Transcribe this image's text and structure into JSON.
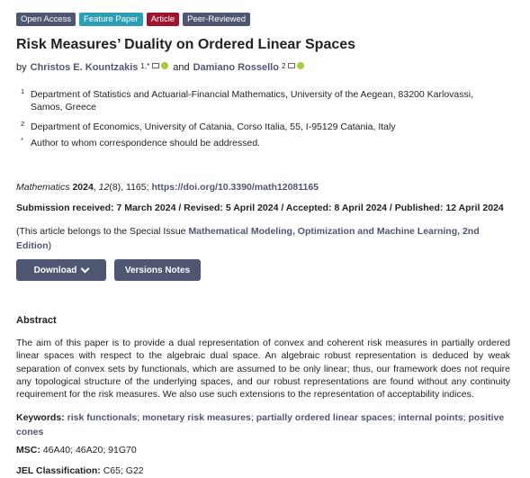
{
  "badges": [
    "Open Access",
    "Feature Paper",
    "Article",
    "Peer-Reviewed"
  ],
  "title": "Risk Measures’ Duality on Ordered Linear Spaces",
  "authors": {
    "by": "by",
    "a1": "Christos E. Kountzakis",
    "a1_sup": "1,*",
    "and": "and",
    "a2": "Damiano Rossello",
    "a2_sup": "2"
  },
  "affiliations": [
    {
      "num": "1",
      "text": "Department of Statistics and Actuarial-Financial Mathematics, University of the Aegean, 83200 Karlovassi, Samos, Greece"
    },
    {
      "num": "2",
      "text": "Department of Economics, University of Catania, Corso Italia, 55, I-95129 Catania, Italy"
    },
    {
      "num": "*",
      "text": "Author to whom correspondence should be addressed."
    }
  ],
  "citation": {
    "journal": "Mathematics",
    "year": "2024",
    "volume": "12",
    "issue": "(8)",
    "article": ", 1165;",
    "doi": "https://doi.org/10.3390/math12081165"
  },
  "dates": "Submission received: 7 March 2024 / Revised: 5 April 2024 / Accepted: 8 April 2024 / Published: 12 April 2024",
  "special_issue": {
    "prefix": "(This article belongs to the Special Issue ",
    "link": "Mathematical Modeling, Optimization and Machine Learning, 2nd Edition",
    "suffix": ")"
  },
  "buttons": {
    "download": "Download",
    "versions": "Versions Notes"
  },
  "abstract": {
    "heading": "Abstract",
    "text": "The aim of this paper is to provide a dual representation of convex and coherent risk measures in partially ordered linear spaces with respect to the algebraic dual space. An algebraic robust representation is deduced by weak separation of convex sets by functionals, which are assumed to be only linear; thus, our framework does not require any topological structure of the underlying spaces, and our robust representations are found without any continuity requirement for the risk measures. We also use such extensions to the representation of acceptability indices."
  },
  "keywords": {
    "label": "Keywords:",
    "items": [
      "risk functionals",
      "monetary risk measures",
      "partially ordered linear spaces",
      "internal points",
      "positive cones"
    ]
  },
  "msc": {
    "label": "MSC:",
    "value": "46A40; 46A20; 91G70"
  },
  "jel": {
    "label": "JEL Classification:",
    "value": "C65; G22"
  }
}
